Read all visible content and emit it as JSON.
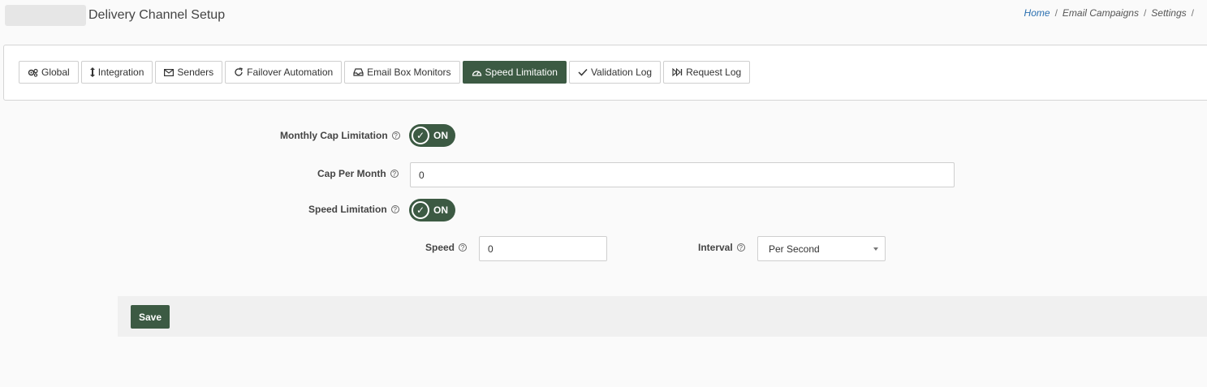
{
  "header": {
    "title": "Delivery Channel Setup",
    "breadcrumb": [
      "Home",
      "Email Campaigns",
      "Settings"
    ]
  },
  "tabs": [
    {
      "label": "Global",
      "icon": "gears-icon",
      "active": false
    },
    {
      "label": "Integration",
      "icon": "vertical-arrows-icon",
      "active": false
    },
    {
      "label": "Senders",
      "icon": "envelope-icon",
      "active": false
    },
    {
      "label": "Failover Automation",
      "icon": "refresh-icon",
      "active": false
    },
    {
      "label": "Email Box Monitors",
      "icon": "inbox-icon",
      "active": false
    },
    {
      "label": "Speed Limitation",
      "icon": "speedometer-icon",
      "active": true
    },
    {
      "label": "Validation Log",
      "icon": "check-icon",
      "active": false
    },
    {
      "label": "Request Log",
      "icon": "fast-forward-icon",
      "active": false
    }
  ],
  "form": {
    "monthly_cap": {
      "label": "Monthly Cap Limitation",
      "toggle_text": "ON"
    },
    "cap_per_month": {
      "label": "Cap Per Month",
      "value": "0"
    },
    "speed_limitation": {
      "label": "Speed Limitation",
      "toggle_text": "ON"
    },
    "speed": {
      "label": "Speed",
      "value": "0"
    },
    "interval": {
      "label": "Interval",
      "value": "Per Second"
    }
  },
  "actions": {
    "save_label": "Save"
  },
  "colors": {
    "accent": "#3c5a43",
    "link": "#2a6fb0"
  }
}
